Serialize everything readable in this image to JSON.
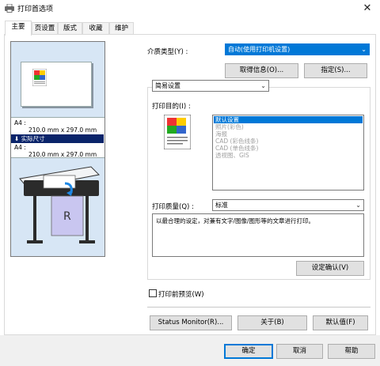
{
  "window": {
    "title": "打印首选项",
    "close_glyph": "✕"
  },
  "tabs": [
    {
      "label": "主要",
      "active": true
    },
    {
      "label": "页设置",
      "active": false
    },
    {
      "label": "版式",
      "active": false
    },
    {
      "label": "收藏",
      "active": false
    },
    {
      "label": "维护",
      "active": false
    }
  ],
  "preview": {
    "source_size_label": "A4 :",
    "source_size_value": "210.0 mm x 297.0 mm",
    "scale_option": "实际尺寸",
    "output_size_label": "A4 :",
    "output_size_value": "210.0 mm x 297.0 mm",
    "printer_label": "R",
    "arrow_glyph": "⬇"
  },
  "media": {
    "label": "介质类型(Y) :",
    "value": "自动(使用打印机设置)",
    "get_info_button": "取得信息(O)...",
    "specify_button": "指定(S)..."
  },
  "mode": {
    "value": "简易设置"
  },
  "purpose": {
    "label": "打印目的(I) :",
    "items": [
      "默认设置",
      "照片(彩色)",
      "海报",
      "CAD (彩色线条)",
      "CAD (单色线条)",
      "透视图、GIS"
    ],
    "selected_index": 0
  },
  "quality": {
    "label": "打印质量(Q) :",
    "value": "标准"
  },
  "description": "以最合理的设定，对兼有文字/图像/图形等的文章进行打印。",
  "confirm_button": "设定确认(V)",
  "preview_checkbox": {
    "label": "打印前预览(W)",
    "checked": false
  },
  "footer_buttons": {
    "status_monitor": "Status Monitor(R)...",
    "about": "关于(B)",
    "defaults": "默认值(F)"
  },
  "dialog_buttons": {
    "ok": "确定",
    "cancel": "取消",
    "help": "帮助"
  },
  "colors": {
    "accent": "#0078d7",
    "preview_bg": "#d7e6f5",
    "highlight": "#0a246a"
  },
  "icons": [
    "printer-icon",
    "close-icon",
    "chevron-down-icon",
    "document-thumbnail-icon",
    "large-format-printer-illustration",
    "down-arrow-icon"
  ]
}
